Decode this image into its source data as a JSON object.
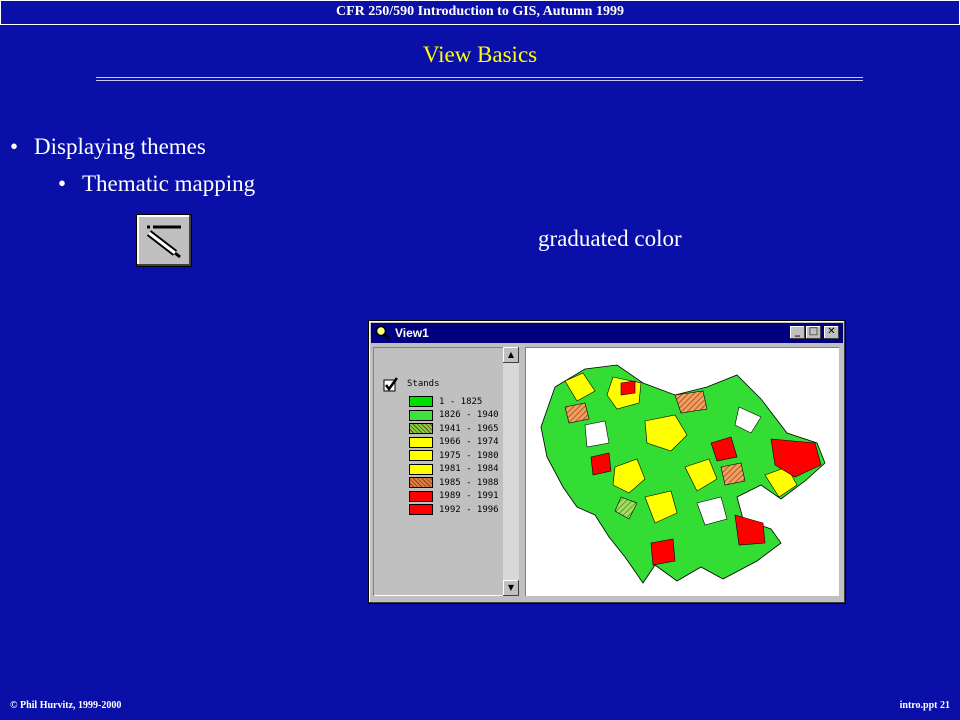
{
  "header": {
    "course_title": "CFR 250/590 Introduction to GIS, Autumn 1999"
  },
  "slide": {
    "title": "View Basics",
    "bullets": [
      "Displaying themes",
      "Thematic mapping"
    ],
    "caption": "graduated color"
  },
  "view_window": {
    "title": "View1",
    "buttons": {
      "minimize": "_",
      "maximize": "□",
      "close": "✕"
    },
    "theme_name": "Stands",
    "theme_checked": true,
    "legend": [
      {
        "label": "1 - 1825",
        "color": "#00e000",
        "pattern": "solid"
      },
      {
        "label": "1826 - 1940",
        "color": "#40e040",
        "pattern": "solid"
      },
      {
        "label": "1941 - 1965",
        "color": "#80d040",
        "pattern": "hatch"
      },
      {
        "label": "1966 - 1974",
        "color": "#ffff00",
        "pattern": "solid"
      },
      {
        "label": "1975 - 1980",
        "color": "#ffff00",
        "pattern": "solid"
      },
      {
        "label": "1981 - 1984",
        "color": "#ffff00",
        "pattern": "solid"
      },
      {
        "label": "1985 - 1988",
        "color": "#e08040",
        "pattern": "hatch"
      },
      {
        "label": "1989 - 1991",
        "color": "#ff0000",
        "pattern": "solid"
      },
      {
        "label": "1992 - 1996",
        "color": "#ff0000",
        "pattern": "solid"
      }
    ]
  },
  "icons": {
    "theme_tool": "theme-properties-icon",
    "view_window": "view-magnifier-icon",
    "checkmark": "checkmark-icon"
  },
  "footer": {
    "copyright": "© Phil Hurvitz, 1999-2000",
    "slide_ref": "intro.ppt 21"
  }
}
